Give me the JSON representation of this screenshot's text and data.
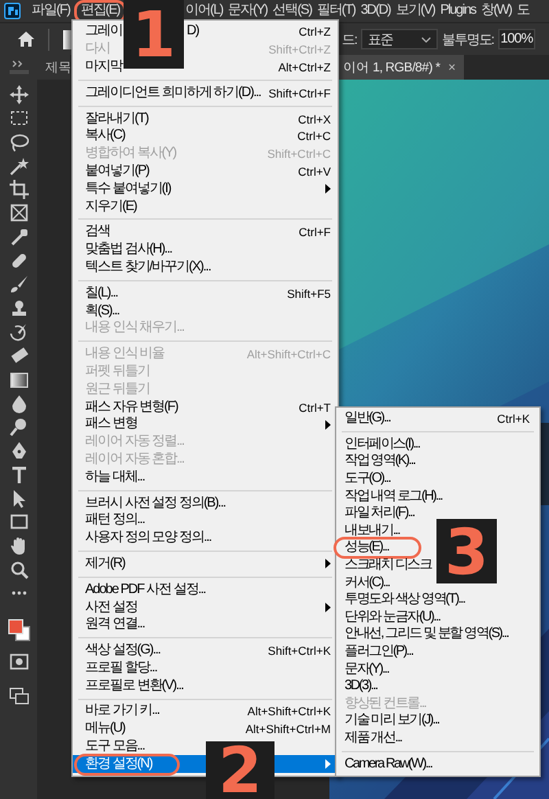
{
  "menubar": {
    "items": [
      {
        "label": "파일(F)",
        "circled": false
      },
      {
        "label": "편집(E)",
        "circled": true
      },
      {
        "label": "이어(L)",
        "circled": false
      },
      {
        "label": "문자(Y)",
        "circled": false
      },
      {
        "label": "선택(S)",
        "circled": false
      },
      {
        "label": "필터(T)",
        "circled": false
      },
      {
        "label": "3D(D)",
        "circled": false
      },
      {
        "label": "보기(V)",
        "circled": false
      },
      {
        "label": "Plugins",
        "circled": false
      },
      {
        "label": "창(W)",
        "circled": false
      },
      {
        "label": "도",
        "circled": false
      }
    ]
  },
  "options_bar": {
    "mode_label": "드:",
    "mode_value": "표준",
    "opacity_label": "불투명도:",
    "opacity_value": "100%"
  },
  "tabs": [
    {
      "label": "제목",
      "selected": false
    },
    {
      "label": "이어 1, RGB/8#) *",
      "selected": true,
      "close": "×"
    }
  ],
  "edit_menu": {
    "groups": [
      {
        "items": [
          {
            "label": "그레이",
            "tail": "D)",
            "shortcut": "Ctrl+Z",
            "disabled": false,
            "submenu": false,
            "selected": false,
            "circled": false
          },
          {
            "label": "다시",
            "shortcut": "Shift+Ctrl+Z",
            "disabled": true,
            "submenu": false,
            "selected": false,
            "circled": false
          },
          {
            "label": "마지막",
            "shortcut": "Alt+Ctrl+Z",
            "disabled": false,
            "submenu": false,
            "selected": false,
            "circled": false
          }
        ]
      },
      {
        "items": [
          {
            "label": "그레이디언트 희미하게 하기(D)...",
            "shortcut": "Shift+Ctrl+F",
            "disabled": false,
            "submenu": false,
            "selected": false,
            "circled": false
          }
        ]
      },
      {
        "items": [
          {
            "label": "잘라내기(T)",
            "shortcut": "Ctrl+X",
            "disabled": false,
            "submenu": false,
            "selected": false,
            "circled": false
          },
          {
            "label": "복사(C)",
            "shortcut": "Ctrl+C",
            "disabled": false,
            "submenu": false,
            "selected": false,
            "circled": false
          },
          {
            "label": "병합하여 복사(Y)",
            "shortcut": "Shift+Ctrl+C",
            "disabled": true,
            "submenu": false,
            "selected": false,
            "circled": false
          },
          {
            "label": "붙여넣기(P)",
            "shortcut": "Ctrl+V",
            "disabled": false,
            "submenu": false,
            "selected": false,
            "circled": false
          },
          {
            "label": "특수 붙여넣기(I)",
            "disabled": false,
            "submenu": true,
            "selected": false,
            "circled": false
          },
          {
            "label": "지우기(E)",
            "disabled": false,
            "submenu": false,
            "selected": false,
            "circled": false
          }
        ]
      },
      {
        "items": [
          {
            "label": "검색",
            "shortcut": "Ctrl+F",
            "disabled": false,
            "submenu": false,
            "selected": false,
            "circled": false
          },
          {
            "label": "맞춤법 검사(H)...",
            "disabled": false,
            "submenu": false,
            "selected": false,
            "circled": false
          },
          {
            "label": "텍스트 찾기/바꾸기(X)...",
            "disabled": false,
            "submenu": false,
            "selected": false,
            "circled": false
          }
        ]
      },
      {
        "items": [
          {
            "label": "칠(L)...",
            "shortcut": "Shift+F5",
            "disabled": false,
            "submenu": false,
            "selected": false,
            "circled": false
          },
          {
            "label": "획(S)...",
            "disabled": false,
            "submenu": false,
            "selected": false,
            "circled": false
          },
          {
            "label": "내용 인식 채우기...",
            "disabled": true,
            "submenu": false,
            "selected": false,
            "circled": false
          }
        ]
      },
      {
        "items": [
          {
            "label": "내용 인식 비율",
            "shortcut": "Alt+Shift+Ctrl+C",
            "disabled": true,
            "submenu": false,
            "selected": false,
            "circled": false
          },
          {
            "label": "퍼펫 뒤틀기",
            "disabled": true,
            "submenu": false,
            "selected": false,
            "circled": false
          },
          {
            "label": "원근 뒤틀기",
            "disabled": true,
            "submenu": false,
            "selected": false,
            "circled": false
          },
          {
            "label": "패스 자유 변형(F)",
            "shortcut": "Ctrl+T",
            "disabled": false,
            "submenu": false,
            "selected": false,
            "circled": false
          },
          {
            "label": "패스 변형",
            "disabled": false,
            "submenu": true,
            "selected": false,
            "circled": false
          },
          {
            "label": "레이어 자동 정렬...",
            "disabled": true,
            "submenu": false,
            "selected": false,
            "circled": false
          },
          {
            "label": "레이어 자동 혼합...",
            "disabled": true,
            "submenu": false,
            "selected": false,
            "circled": false
          },
          {
            "label": "하늘 대체...",
            "disabled": false,
            "submenu": false,
            "selected": false,
            "circled": false
          }
        ]
      },
      {
        "items": [
          {
            "label": "브러시 사전 설정 정의(B)...",
            "disabled": false,
            "submenu": false,
            "selected": false,
            "circled": false
          },
          {
            "label": "패턴 정의...",
            "disabled": false,
            "submenu": false,
            "selected": false,
            "circled": false
          },
          {
            "label": "사용자 정의 모양 정의...",
            "disabled": false,
            "submenu": false,
            "selected": false,
            "circled": false
          }
        ]
      },
      {
        "items": [
          {
            "label": "제거(R)",
            "disabled": false,
            "submenu": true,
            "selected": false,
            "circled": false
          }
        ]
      },
      {
        "items": [
          {
            "label": "Adobe PDF 사전 설정...",
            "disabled": false,
            "submenu": false,
            "selected": false,
            "circled": false
          },
          {
            "label": "사전 설정",
            "disabled": false,
            "submenu": true,
            "selected": false,
            "circled": false
          },
          {
            "label": "원격 연결...",
            "disabled": false,
            "submenu": false,
            "selected": false,
            "circled": false
          }
        ]
      },
      {
        "items": [
          {
            "label": "색상 설정(G)...",
            "shortcut": "Shift+Ctrl+K",
            "disabled": false,
            "submenu": false,
            "selected": false,
            "circled": false
          },
          {
            "label": "프로필 할당...",
            "disabled": false,
            "submenu": false,
            "selected": false,
            "circled": false
          },
          {
            "label": "프로필로 변환(V)...",
            "disabled": false,
            "submenu": false,
            "selected": false,
            "circled": false
          }
        ]
      },
      {
        "items": [
          {
            "label": "바로 가기 키...",
            "shortcut": "Alt+Shift+Ctrl+K",
            "disabled": false,
            "submenu": false,
            "selected": false,
            "circled": false
          },
          {
            "label": "메뉴(U)",
            "shortcut": "Alt+Shift+Ctrl+M",
            "disabled": false,
            "submenu": false,
            "selected": false,
            "circled": false
          },
          {
            "label": "도구 모음...",
            "disabled": false,
            "submenu": false,
            "selected": false,
            "circled": false
          },
          {
            "label": "환경 설정(N)",
            "disabled": false,
            "submenu": true,
            "selected": true,
            "circled": true
          }
        ]
      }
    ]
  },
  "preferences_submenu": {
    "groups": [
      {
        "items": [
          {
            "label": "일반(G)...",
            "shortcut": "Ctrl+K",
            "disabled": false,
            "submenu": false,
            "selected": false,
            "circled": false
          }
        ]
      },
      {
        "items": [
          {
            "label": "인터페이스(I)...",
            "disabled": false,
            "submenu": false,
            "selected": false,
            "circled": false
          },
          {
            "label": "작업 영역(K)...",
            "disabled": false,
            "submenu": false,
            "selected": false,
            "circled": false
          },
          {
            "label": "도구(O)...",
            "disabled": false,
            "submenu": false,
            "selected": false,
            "circled": false
          },
          {
            "label": "작업 내역 로그(H)...",
            "disabled": false,
            "submenu": false,
            "selected": false,
            "circled": false
          },
          {
            "label": "파일 처리(F)...",
            "disabled": false,
            "submenu": false,
            "selected": false,
            "circled": false
          },
          {
            "label": "내보내기...",
            "disabled": false,
            "submenu": false,
            "selected": false,
            "circled": false
          },
          {
            "label": "성능(E)...",
            "disabled": false,
            "submenu": false,
            "selected": false,
            "circled": true
          },
          {
            "label": "스크래치 디스크",
            "disabled": false,
            "submenu": false,
            "selected": false,
            "circled": false
          },
          {
            "label": "커서(C)...",
            "disabled": false,
            "submenu": false,
            "selected": false,
            "circled": false
          },
          {
            "label": "투명도와 색상 영역(T)...",
            "disabled": false,
            "submenu": false,
            "selected": false,
            "circled": false
          },
          {
            "label": "단위와 눈금자(U)...",
            "disabled": false,
            "submenu": false,
            "selected": false,
            "circled": false
          },
          {
            "label": "안내선, 그리드 및 분할 영역(S)...",
            "disabled": false,
            "submenu": false,
            "selected": false,
            "circled": false
          },
          {
            "label": "플러그인(P)...",
            "disabled": false,
            "submenu": false,
            "selected": false,
            "circled": false
          },
          {
            "label": "문자(Y)...",
            "disabled": false,
            "submenu": false,
            "selected": false,
            "circled": false
          },
          {
            "label": "3D(3)...",
            "disabled": false,
            "submenu": false,
            "selected": false,
            "circled": false
          },
          {
            "label": "향상된 컨트롤...",
            "disabled": true,
            "submenu": false,
            "selected": false,
            "circled": false
          },
          {
            "label": "기술 미리 보기(J)...",
            "disabled": false,
            "submenu": false,
            "selected": false,
            "circled": false
          },
          {
            "label": "제품 개선...",
            "disabled": false,
            "submenu": false,
            "selected": false,
            "circled": false
          }
        ]
      },
      {
        "items": [
          {
            "label": "Camera Raw(W)...",
            "disabled": false,
            "submenu": false,
            "selected": false,
            "circled": false
          }
        ]
      }
    ]
  },
  "callouts": [
    {
      "number": "1"
    },
    {
      "number": "2"
    },
    {
      "number": "3"
    }
  ]
}
